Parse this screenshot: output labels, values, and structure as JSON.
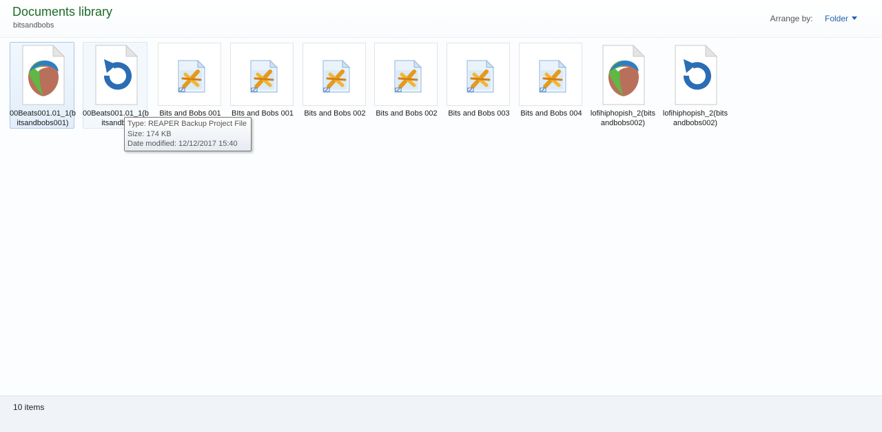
{
  "header": {
    "title": "Documents library",
    "subtitle": "bitsandbobs",
    "arrange_label": "Arrange by:",
    "arrange_value": "Folder"
  },
  "colors": {
    "title_green": "#1e6b28",
    "link_blue": "#1f5fa8",
    "selection_border": "#a7c9ea"
  },
  "files": [
    {
      "name": "00Beats001.01_1(bitsandbobs001)",
      "icon": "reaper-project-icon",
      "state": "selected"
    },
    {
      "name": "00Beats001.01_1(bitsandbo",
      "icon": "reaper-backup-icon",
      "state": "hovered"
    },
    {
      "name": "Bits and Bobs 001",
      "icon": "media-shortcut-icon",
      "state": ""
    },
    {
      "name": "BIts and Bobs 001",
      "icon": "media-shortcut-icon",
      "state": ""
    },
    {
      "name": "Bits and Bobs 002",
      "icon": "media-shortcut-icon",
      "state": ""
    },
    {
      "name": "Bits and Bobs 002",
      "icon": "media-shortcut-icon",
      "state": ""
    },
    {
      "name": "Bits and Bobs 003",
      "icon": "media-shortcut-icon",
      "state": ""
    },
    {
      "name": "Bits and Bobs 004",
      "icon": "media-shortcut-icon",
      "state": ""
    },
    {
      "name": "lofihiphopish_2(bitsandbobs002)",
      "icon": "reaper-project-icon",
      "state": ""
    },
    {
      "name": "lofihiphopish_2(bitsandbobs002)",
      "icon": "reaper-backup-icon",
      "state": ""
    }
  ],
  "tooltip": {
    "type": "Type: REAPER Backup Project File",
    "size": "Size: 174 KB",
    "modified": "Date modified: 12/12/2017 15:40"
  },
  "status": {
    "item_count": "10 items"
  }
}
